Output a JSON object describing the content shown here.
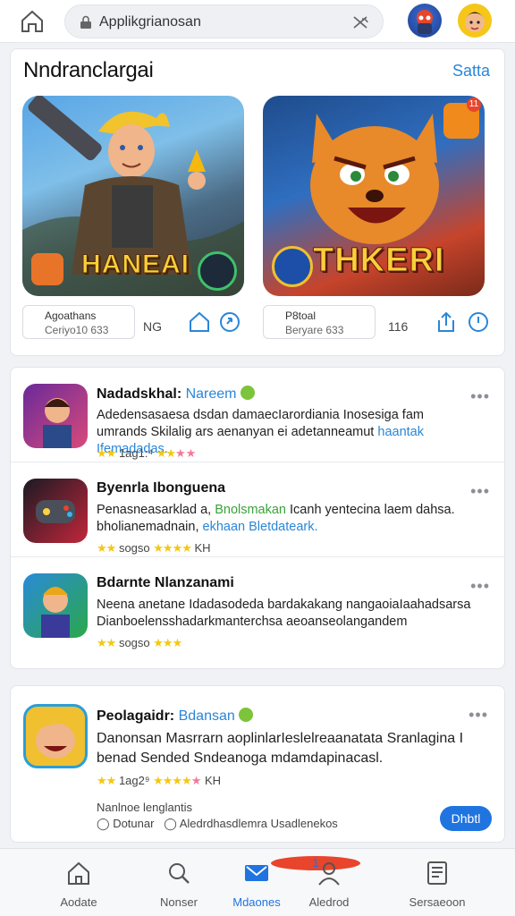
{
  "search": {
    "value": "Applikgrianosan"
  },
  "featured": {
    "title": "Nndranclargai",
    "see_all": "Satta",
    "games": [
      {
        "art_title": "HANEAI",
        "meta_title": "Agoathans",
        "meta_sub": "Ceriyo10 633",
        "count": "NG"
      },
      {
        "art_title": "THKERI",
        "meta_title": "P8toal",
        "meta_sub": "Beryare 633",
        "count": "116",
        "badge": "11"
      }
    ]
  },
  "apps": [
    {
      "name": "Nadadskhal:",
      "tag": "Nareem",
      "desc": "Adedensasaesa dsdan damaecIarordiania Inosesiga fam umrands Skilalig ars aenanyan ei adetanneamut",
      "desc_hl": "haantak Ifemadadas.",
      "rating": "1ag1:⁴",
      "extra": ""
    },
    {
      "name": "Byenrla Ibonguena",
      "tag": "",
      "desc": "Penasneasarklad a,",
      "desc_hl": "Bnolsmakan",
      "desc_rest": "Icanh yentecina laem dahsa. bholianemadnain,",
      "desc_hl2": "ekhaan Bletdateark.",
      "rating": "sogso",
      "extra": "KH"
    },
    {
      "name": "Bdarnte Nlanzanami",
      "tag": "",
      "desc": "Neena anetane Idadasodeda bardakakang nangaoiaIaahadsarsa Dianboelensshadarkmanterchsa aeoanseolangandem",
      "desc_hl": "",
      "rating": "sogso",
      "extra": ""
    }
  ],
  "promo": {
    "name": "Peolagaidr:",
    "tag": "Bdansan",
    "desc": "Danonsan Masrrarn aoplinlarIeslelreaanatata Sranlagina I benad Sended Sndeanoga mdamdapinacasl.",
    "rating": "1ag2⁹",
    "extra": "KH",
    "foot1": "Nanlnoe lenglantis",
    "foot_a": "Dotunar",
    "foot_b": "Aledrdhasdlemra Usadlenekos",
    "button": "Dhbtl"
  },
  "nav": [
    {
      "label": "Aodate",
      "icon": "home-icon"
    },
    {
      "label": "Nonser",
      "icon": "search-icon"
    },
    {
      "label": "Mdaones",
      "icon": "message-icon",
      "badge": "1"
    },
    {
      "label": "Aledrod",
      "icon": "person-icon"
    },
    {
      "label": "Sersaeoon",
      "icon": "document-icon"
    }
  ],
  "colors": {
    "accent": "#1f74e0",
    "link": "#2a86d8",
    "star": "#f2c812"
  }
}
